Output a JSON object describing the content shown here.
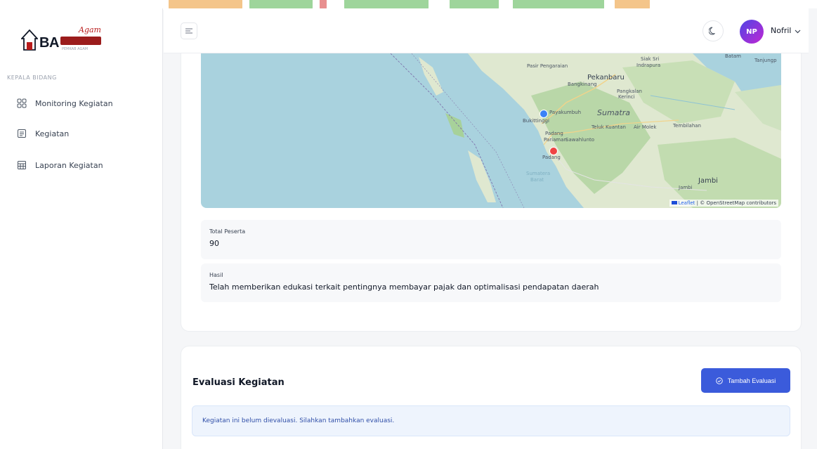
{
  "app": {
    "logo_text": "BA",
    "logo_script": "Agam",
    "logo_sub": "PEMKAB AGAM"
  },
  "colors": {
    "primary": "#3b5bdb",
    "avatar_start": "#4f46e5",
    "avatar_end": "#c026d3",
    "marker_blue": "#3b82f6",
    "marker_red": "#ef4444",
    "info_bg": "#eef4fd",
    "info_text": "#2f4ea8"
  },
  "sidebar": {
    "section_label": "KEPALA BIDANG",
    "items": [
      {
        "label": "Monitoring Kegiatan",
        "icon": "grid-icon"
      },
      {
        "label": "Kegiatan",
        "icon": "document-icon"
      },
      {
        "label": "Laporan Kegiatan",
        "icon": "table-icon"
      }
    ]
  },
  "header": {
    "menu_icon": "menu-icon",
    "theme_icon": "moon-icon",
    "user_initials": "NP",
    "user_name": "Nofril"
  },
  "map": {
    "places": {
      "batam": "Batam",
      "tanjung": "Tanjungp",
      "siak": "Siak Sri",
      "indrapura": "Indrapura",
      "pasir": "Pasir Pengaraian",
      "pekanbaru": "Pekanbaru",
      "bangkinang": "Bangkinang",
      "pangkalan": "Pangkalan",
      "kerinci": "Kerinci",
      "payakumbuh": "Payakumbuh",
      "sumatra": "Sumatra",
      "bukittinggi": "Bukittinggi",
      "teluk": "Teluk Kuantan",
      "airmolek": "Air Molek",
      "tembilahan": "Tembilahan",
      "pariaman1": "Padang",
      "pariaman2": "Pariaman",
      "sawahlunto": "Sawahlunto",
      "padang": "Padang",
      "sumbar1": "Sumatera",
      "sumbar2": "Barat",
      "jambi": "Jambi",
      "jambi2": "Jambi"
    },
    "attribution_leaflet": "Leaflet",
    "attribution_rest": "| © OpenStreetMap contributors"
  },
  "details": {
    "total_label": "Total Peserta",
    "total_value": "90",
    "hasil_label": "Hasil",
    "hasil_value": "Telah memberikan edukasi terkait pentingnya membayar pajak dan optimalisasi pendapatan daerah"
  },
  "evaluasi": {
    "title": "Evaluasi Kegiatan",
    "button_label": "Tambah Evaluasi",
    "button_icon": "check-circle-icon",
    "empty_note": "Kegiatan ini belum dievaluasi. Silahkan tambahkan evaluasi."
  }
}
